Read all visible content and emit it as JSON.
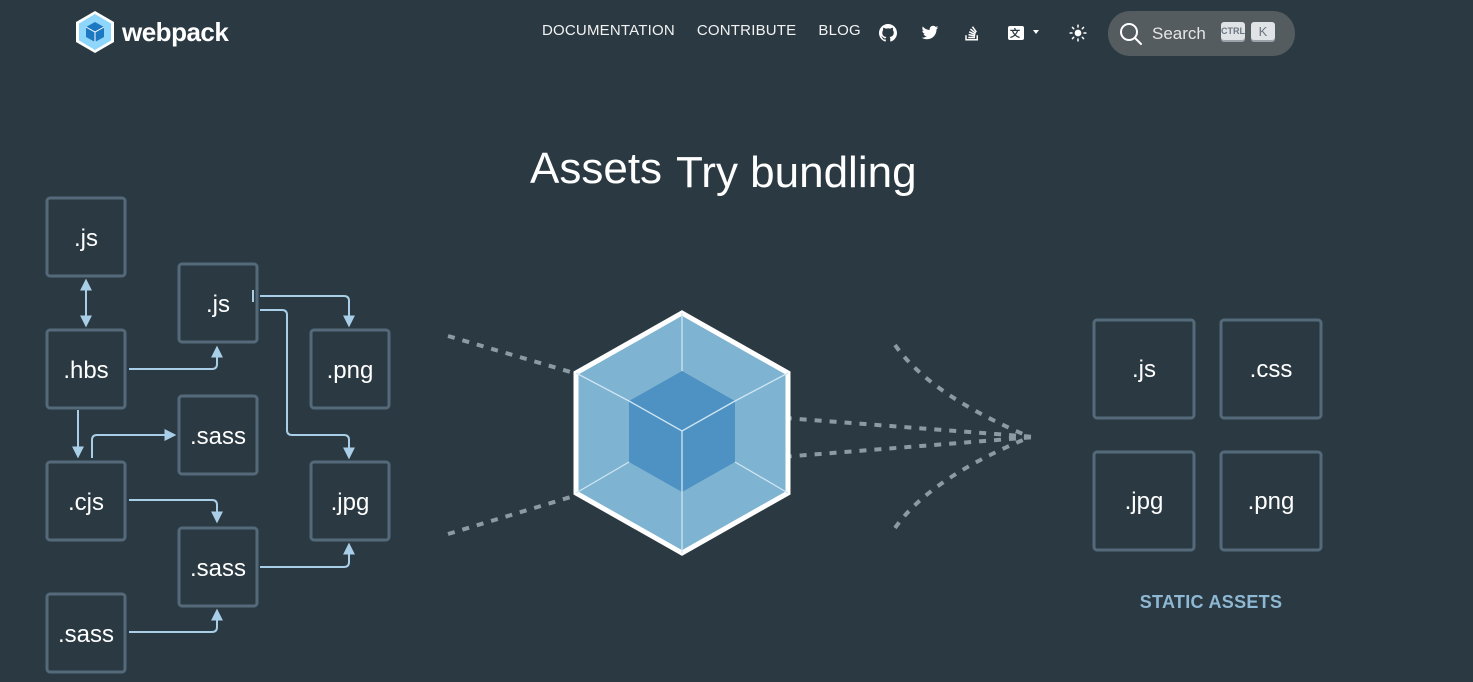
{
  "header": {
    "logo_text": "webpack",
    "nav": [
      "DOCUMENTATION",
      "CONTRIBUTE",
      "BLOG"
    ],
    "icons": [
      "github-icon",
      "twitter-icon",
      "stackoverflow-icon",
      "language-icon",
      "theme-toggle-icon"
    ],
    "search": {
      "label": "Search",
      "shortcut_modifier": "CTRL",
      "shortcut_key": "K"
    }
  },
  "hero": {
    "title_word_1": "Assets",
    "title_word_2": "Try bundling"
  },
  "modules": [
    ".js",
    ".hbs",
    ".cjs",
    ".sass",
    ".js",
    ".sass",
    ".sass",
    ".png",
    ".jpg"
  ],
  "output": {
    "assets": [
      ".js",
      ".css",
      ".jpg",
      ".png"
    ],
    "caption": "STATIC ASSETS"
  },
  "colors": {
    "background": "#2b3a42",
    "box_border": "#546a7b",
    "arrow": "#a9cfe8",
    "cube_outer": "#8dd6f9",
    "cube_inner": "#1c78c0",
    "caption": "#8eb8d3"
  }
}
